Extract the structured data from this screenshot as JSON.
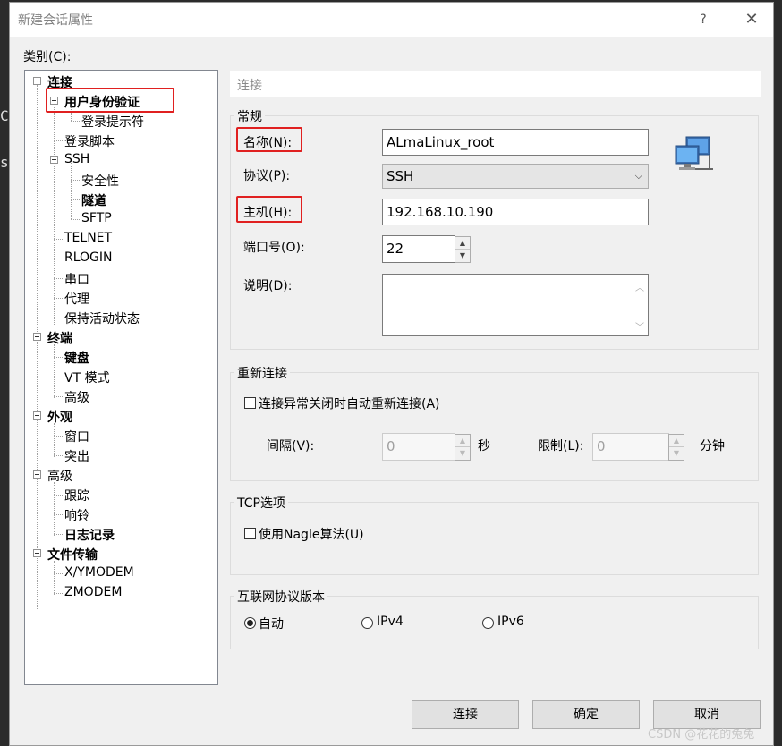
{
  "background": {
    "left_letters": [
      "C",
      "s"
    ]
  },
  "window": {
    "title": "新建会话属性",
    "help_glyph": "?",
    "close_glyph": "✕"
  },
  "category_label": "类别(C):",
  "tree": {
    "connection": "连接",
    "auth": "用户身份验证",
    "login_prompt": "登录提示符",
    "login_script": "登录脚本",
    "ssh": "SSH",
    "security": "安全性",
    "tunnel": "隧道",
    "sftp": "SFTP",
    "telnet": "TELNET",
    "rlogin": "RLOGIN",
    "serial": "串口",
    "proxy": "代理",
    "keepalive": "保持活动状态",
    "terminal": "终端",
    "keyboard": "键盘",
    "vt_mode": "VT 模式",
    "terminal_advanced": "高级",
    "appearance": "外观",
    "window_item": "窗口",
    "highlight": "突出",
    "advanced": "高级",
    "trace": "跟踪",
    "bell": "响铃",
    "logging": "日志记录",
    "file_transfer": "文件传输",
    "xymodem": "X/YMODEM",
    "zmodem": "ZMODEM"
  },
  "panel": {
    "header": "连接",
    "general": {
      "title": "常规",
      "name_label": "名称(N):",
      "name_value": "ALmaLinux_root",
      "protocol_label": "协议(P):",
      "protocol_value": "SSH",
      "host_label": "主机(H):",
      "host_value": "192.168.10.190",
      "port_label": "端口号(O):",
      "port_value": "22",
      "desc_label": "说明(D):",
      "desc_value": ""
    },
    "reconnect": {
      "title": "重新连接",
      "checkbox_label": "连接异常关闭时自动重新连接(A)",
      "interval_label": "间隔(V):",
      "interval_value": "0",
      "interval_unit": "秒",
      "limit_label": "限制(L):",
      "limit_value": "0",
      "limit_unit": "分钟"
    },
    "tcp": {
      "title": "TCP选项",
      "nagle_label": "使用Nagle算法(U)"
    },
    "ip_version": {
      "title": "互联网协议版本",
      "options": [
        "自动",
        "IPv4",
        "IPv6"
      ],
      "selected": "自动"
    }
  },
  "buttons": {
    "connect": "连接",
    "ok": "确定",
    "cancel": "取消"
  },
  "watermark": "CSDN @花花的兔兔"
}
